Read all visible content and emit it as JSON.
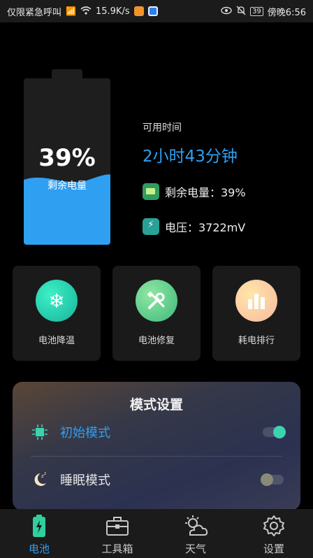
{
  "status_bar": {
    "carrier": "仅限紧急呼叫",
    "net_speed": "15.9K/s",
    "battery_level": "39",
    "time": "傍晚6:56"
  },
  "battery": {
    "percent": "39%",
    "percent_label": "剩余电量",
    "level_fraction": 0.39
  },
  "info": {
    "title": "可用时间",
    "time_remaining": "2小时43分钟",
    "remaining_row": "剩余电量：39%",
    "voltage_row": "电压：3722mV"
  },
  "tools": [
    {
      "label": "电池降温",
      "icon": "snowflake-icon"
    },
    {
      "label": "电池修复",
      "icon": "wrench-screwdriver-icon"
    },
    {
      "label": "耗电排行",
      "icon": "bar-chart-icon"
    }
  ],
  "mode_settings": {
    "title": "模式设置",
    "modes": [
      {
        "label": "初始模式",
        "icon": "chip-icon",
        "enabled": true,
        "color": "#2f9ff2"
      },
      {
        "label": "睡眠模式",
        "icon": "moon-sleep-icon",
        "enabled": false,
        "color": "#e6e6e6"
      }
    ]
  },
  "bottom_nav": [
    {
      "label": "电池",
      "icon": "battery-charging-icon",
      "active": true
    },
    {
      "label": "工具箱",
      "icon": "toolbox-icon",
      "active": false
    },
    {
      "label": "天气",
      "icon": "weather-icon",
      "active": false
    },
    {
      "label": "设置",
      "icon": "gear-icon",
      "active": false
    }
  ],
  "colors": {
    "accent": "#2f9ff2",
    "wave": "#2f9ff2",
    "toggle_on": "#3cd3b0"
  }
}
